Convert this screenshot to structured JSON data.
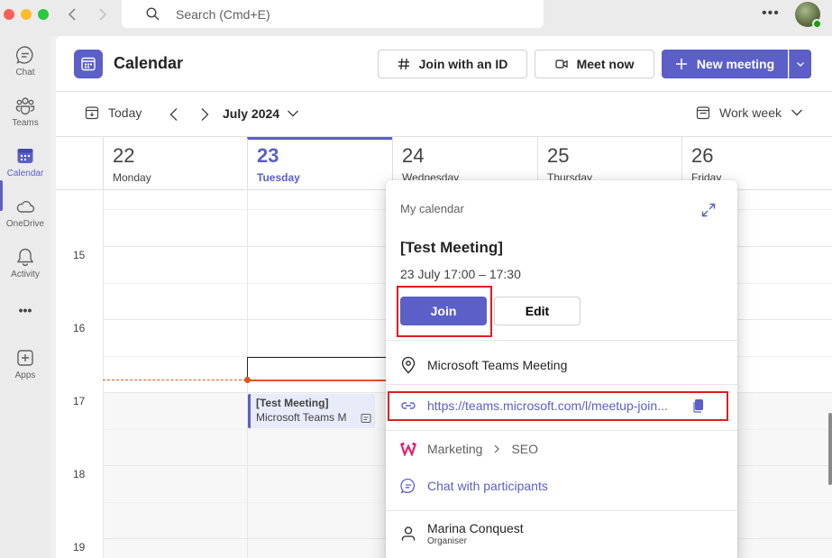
{
  "titlebar": {
    "search_placeholder": "Search (Cmd+E)",
    "more": "•••"
  },
  "rail": {
    "items": [
      {
        "label": "Chat",
        "icon": "chat-icon"
      },
      {
        "label": "Teams",
        "icon": "teams-icon"
      },
      {
        "label": "Calendar",
        "icon": "calendar-icon",
        "active": true
      },
      {
        "label": "OneDrive",
        "icon": "cloud-icon"
      },
      {
        "label": "Activity",
        "icon": "bell-icon"
      },
      {
        "label": "•••",
        "icon": "more-icon"
      },
      {
        "label": "Apps",
        "icon": "apps-icon"
      }
    ]
  },
  "header": {
    "title": "Calendar",
    "join_id_label": "Join with an ID",
    "meet_now_label": "Meet now",
    "new_meeting_label": "New meeting"
  },
  "toolbar": {
    "today_label": "Today",
    "month_label": "July 2024",
    "view_label": "Work week"
  },
  "days": [
    {
      "num": "22",
      "name": "Monday"
    },
    {
      "num": "23",
      "name": "Tuesday",
      "today": true
    },
    {
      "num": "24",
      "name": "Wednesday"
    },
    {
      "num": "25",
      "name": "Thursday"
    },
    {
      "num": "26",
      "name": "Friday"
    }
  ],
  "hours": [
    "15",
    "16",
    "17",
    "18",
    "19"
  ],
  "event": {
    "title": "[Test Meeting]",
    "location": "Microsoft Teams M"
  },
  "popup": {
    "calendar_label": "My calendar",
    "title": "[Test Meeting]",
    "time": "23 July 17:00 – 17:30",
    "join_label": "Join",
    "edit_label": "Edit",
    "location": "Microsoft Teams Meeting",
    "link": "https://teams.microsoft.com/l/meetup-join...",
    "team": "Marketing",
    "channel": "SEO",
    "chat_label": "Chat with participants",
    "organiser_name": "Marina Conquest",
    "organiser_role": "Organiser"
  },
  "colors": {
    "accent": "#5b5fc7",
    "highlight": "#e01e1e",
    "now_line": "#e0571c"
  }
}
